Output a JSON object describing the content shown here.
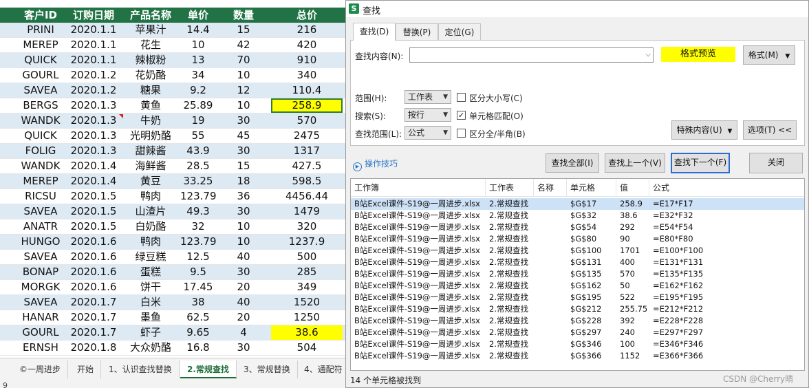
{
  "sheet": {
    "headers": [
      "客户ID",
      "订购日期",
      "产品名称",
      "单价",
      "数量",
      "总价"
    ],
    "rows": [
      [
        "PRINI",
        "2020.1.1",
        "苹果汁",
        "14.4",
        "15",
        "216"
      ],
      [
        "MEREP",
        "2020.1.1",
        "花生",
        "10",
        "42",
        "420"
      ],
      [
        "QUICK",
        "2020.1.1",
        "辣椒粉",
        "13",
        "70",
        "910"
      ],
      [
        "GOURL",
        "2020.1.2",
        "花奶酪",
        "34",
        "10",
        "340"
      ],
      [
        "SAVEA",
        "2020.1.2",
        "糖果",
        "9.2",
        "12",
        "110.4"
      ],
      [
        "BERGS",
        "2020.1.3",
        "黄鱼",
        "25.89",
        "10",
        "258.9"
      ],
      [
        "WANDK",
        "2020.1.3",
        "牛奶",
        "19",
        "30",
        "570"
      ],
      [
        "QUICK",
        "2020.1.3",
        "光明奶酪",
        "55",
        "45",
        "2475"
      ],
      [
        "FOLIG",
        "2020.1.3",
        "甜辣酱",
        "43.9",
        "30",
        "1317"
      ],
      [
        "WANDK",
        "2020.1.4",
        "海鲜酱",
        "28.5",
        "15",
        "427.5"
      ],
      [
        "MEREP",
        "2020.1.4",
        "黄豆",
        "33.25",
        "18",
        "598.5"
      ],
      [
        "RICSU",
        "2020.1.5",
        "鸭肉",
        "123.79",
        "36",
        "4456.44"
      ],
      [
        "SAVEA",
        "2020.1.5",
        "山渣片",
        "49.3",
        "30",
        "1479"
      ],
      [
        "ANATR",
        "2020.1.5",
        "白奶酪",
        "32",
        "10",
        "320"
      ],
      [
        "HUNGO",
        "2020.1.6",
        "鸭肉",
        "123.79",
        "10",
        "1237.9"
      ],
      [
        "SAVEA",
        "2020.1.6",
        "绿豆糕",
        "12.5",
        "40",
        "500"
      ],
      [
        "BONAP",
        "2020.1.6",
        "蛋糕",
        "9.5",
        "30",
        "285"
      ],
      [
        "MORGK",
        "2020.1.6",
        "饼干",
        "17.45",
        "20",
        "349"
      ],
      [
        "SAVEA",
        "2020.1.7",
        "白米",
        "38",
        "40",
        "1520"
      ],
      [
        "HANAR",
        "2020.1.7",
        "墨鱼",
        "62.5",
        "20",
        "1250"
      ],
      [
        "GOURL",
        "2020.1.7",
        "虾子",
        "9.65",
        "4",
        "38.6"
      ],
      [
        "ERNSH",
        "2020.1.8",
        "大众奶酪",
        "16.8",
        "30",
        "504"
      ]
    ],
    "highlight_color": "#ffff00",
    "header_color": "#217346",
    "tabs": [
      "©一周进步",
      "开始",
      "1、认识查找替换",
      "2.常规查找",
      "3、常规替换",
      "4、通配符"
    ],
    "active_tab": "2.常规查找"
  },
  "dialog": {
    "app_icon": "S",
    "title": "查找",
    "tabs": [
      "查找(D)",
      "替换(P)",
      "定位(G)"
    ],
    "find_label": "查找内容(N):",
    "find_value": "",
    "preview_label": "格式预览",
    "format_button": "格式(M)",
    "scope_label": "范围(H):",
    "scope_value": "工作表",
    "search_label": "搜索(S):",
    "search_value": "按行",
    "lookin_label": "查找范围(L):",
    "lookin_value": "公式",
    "opt_case": "区分大小写(C)",
    "opt_case_checked": false,
    "opt_whole": "单元格匹配(O)",
    "opt_whole_checked": true,
    "opt_width": "区分全/半角(B)",
    "opt_width_checked": false,
    "special_button": "特殊内容(U)",
    "options_button": "选项(T) <<",
    "tips_label": "操作技巧",
    "find_all": "查找全部(I)",
    "find_prev": "查找上一个(V)",
    "find_next": "查找下一个(F)",
    "close": "关闭",
    "columns": [
      "工作簿",
      "工作表",
      "名称",
      "单元格",
      "值",
      "公式"
    ],
    "results": [
      [
        "B站Excel课件-S19@一周进步.xlsx",
        "2.常规查找",
        "",
        "$G$17",
        "258.9",
        "=E17*F17"
      ],
      [
        "B站Excel课件-S19@一周进步.xlsx",
        "2.常规查找",
        "",
        "$G$32",
        "38.6",
        "=E32*F32"
      ],
      [
        "B站Excel课件-S19@一周进步.xlsx",
        "2.常规查找",
        "",
        "$G$54",
        "292",
        "=E54*F54"
      ],
      [
        "B站Excel课件-S19@一周进步.xlsx",
        "2.常规查找",
        "",
        "$G$80",
        "90",
        "=E80*F80"
      ],
      [
        "B站Excel课件-S19@一周进步.xlsx",
        "2.常规查找",
        "",
        "$G$100",
        "1701",
        "=E100*F100"
      ],
      [
        "B站Excel课件-S19@一周进步.xlsx",
        "2.常规查找",
        "",
        "$G$131",
        "400",
        "=E131*F131"
      ],
      [
        "B站Excel课件-S19@一周进步.xlsx",
        "2.常规查找",
        "",
        "$G$135",
        "570",
        "=E135*F135"
      ],
      [
        "B站Excel课件-S19@一周进步.xlsx",
        "2.常规查找",
        "",
        "$G$162",
        "50",
        "=E162*F162"
      ],
      [
        "B站Excel课件-S19@一周进步.xlsx",
        "2.常规查找",
        "",
        "$G$195",
        "522",
        "=E195*F195"
      ],
      [
        "B站Excel课件-S19@一周进步.xlsx",
        "2.常规查找",
        "",
        "$G$212",
        "255.75",
        "=E212*F212"
      ],
      [
        "B站Excel课件-S19@一周进步.xlsx",
        "2.常规查找",
        "",
        "$G$228",
        "392",
        "=E228*F228"
      ],
      [
        "B站Excel课件-S19@一周进步.xlsx",
        "2.常规查找",
        "",
        "$G$297",
        "240",
        "=E297*F297"
      ],
      [
        "B站Excel课件-S19@一周进步.xlsx",
        "2.常规查找",
        "",
        "$G$346",
        "100",
        "=E346*F346"
      ],
      [
        "B站Excel课件-S19@一周进步.xlsx",
        "2.常规查找",
        "",
        "$G$366",
        "1152",
        "=E366*F366"
      ]
    ],
    "status": "14 个单元格被找到",
    "watermark": "CSDN @Cherry晴"
  }
}
